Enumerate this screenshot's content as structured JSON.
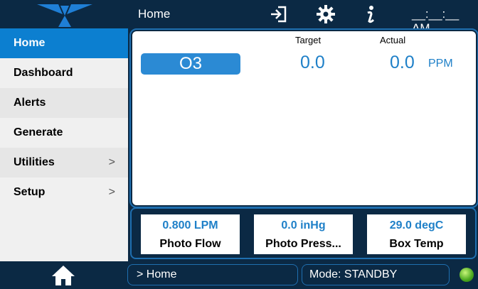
{
  "header": {
    "title": "Home",
    "clock": "__:__:__ AM",
    "icons": [
      "logout-icon",
      "gear-icon",
      "info-icon"
    ]
  },
  "sidebar": {
    "items": [
      {
        "label": "Home",
        "active": true
      },
      {
        "label": "Dashboard"
      },
      {
        "label": "Alerts"
      },
      {
        "label": "Generate"
      },
      {
        "label": "Utilities",
        "chevron": ">"
      },
      {
        "label": "Setup",
        "chevron": ">"
      }
    ]
  },
  "main": {
    "gas": "O3",
    "target_label": "Target",
    "actual_label": "Actual",
    "target_value": "0.0",
    "actual_value": "0.0",
    "unit": "PPM"
  },
  "tiles": [
    {
      "value": "0.800 LPM",
      "name": "Photo Flow"
    },
    {
      "value": "0.0 inHg",
      "name": "Photo Press..."
    },
    {
      "value": "29.0 degC",
      "name": "Box Temp"
    }
  ],
  "footer": {
    "breadcrumb": "> Home",
    "mode": "Mode: STANDBY"
  },
  "colors": {
    "navy": "#0b2944",
    "accent": "#0c7fd0",
    "value_blue": "#1f80c8",
    "status_green": "#4aa81e"
  }
}
